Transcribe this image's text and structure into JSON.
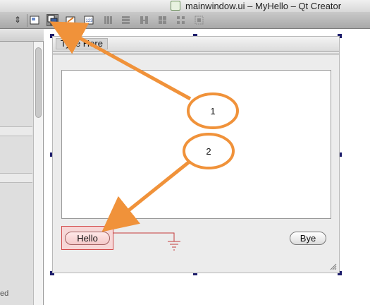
{
  "window": {
    "title": "mainwindow.ui – MyHello – Qt Creator",
    "title_icon": "ui-file-icon"
  },
  "toolbar": {
    "buttons": [
      "edit-widgets-icon",
      "edit-signals-slots-icon",
      "edit-buddies-icon",
      "edit-tab-order-icon",
      "layout-horizontal-icon",
      "layout-vertical-icon",
      "layout-splitter-icon",
      "layout-grid-icon",
      "break-layout-icon",
      "adjust-size-icon"
    ]
  },
  "form": {
    "menu_placeholder": "Type Here",
    "hello_label": "Hello",
    "bye_label": "Bye"
  },
  "annotations": {
    "callout1": "1",
    "callout2": "2",
    "arrow_color": "#f0923a"
  },
  "left_panel": {
    "status_text": "ed"
  }
}
